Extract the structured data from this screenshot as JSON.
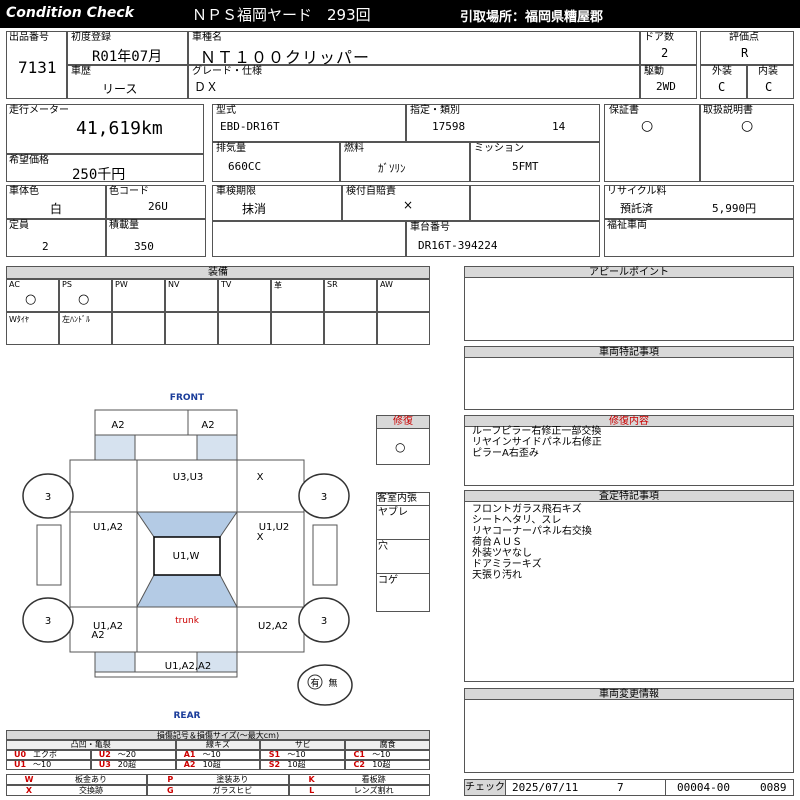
{
  "header": {
    "brand": "Condition Check",
    "auction": "ＮＰＳ福岡ヤード　293回",
    "pickup": "引取場所：福岡県糟屋郡"
  },
  "row1": {
    "lot_label": "出品番号",
    "lot": "7131",
    "first_reg_label": "初度登録",
    "first_reg": "R01年07月",
    "car_name_label": "車種名",
    "car_name": "ＮＴ１００クリッパー",
    "doors_label": "ドア数",
    "doors": "2",
    "rating_label": "評価点",
    "rating": "R",
    "history_label": "車歴",
    "history": "リース",
    "grade_label": "グレード・仕様",
    "grade": "ＤＸ",
    "drive_label": "駆動",
    "drive": "2WD",
    "exterior_label": "外装",
    "exterior": "C",
    "interior_label": "内装",
    "interior": "C"
  },
  "row2": {
    "mileage_label": "走行メーター",
    "mileage": "41,619km",
    "model_label": "型式",
    "model": "EBD-DR16T",
    "designation_label": "指定・類別",
    "designation": "17598",
    "category": "14",
    "warranty_label": "保証書",
    "warranty": "○",
    "manual_label": "取扱説明書",
    "manual": "○",
    "price_label": "希望価格",
    "price": "250千円",
    "displacement_label": "排気量",
    "displacement": "660CC",
    "fuel_label": "燃料",
    "fuel": "ｶﾞｿﾘﾝ",
    "transmission_label": "ミッション",
    "transmission": "5FMT"
  },
  "row3": {
    "body_color_label": "車体色",
    "body_color": "白",
    "color_code_label": "色コード",
    "color_code": "26U",
    "inspection_label": "車検期限",
    "inspection": "抹消",
    "insurance_label": "検付自賠責",
    "insurance": "×",
    "recycle_label": "リサイクル料",
    "recycle_status": "預託済",
    "recycle_fee": "5,990円",
    "capacity_label": "定員",
    "capacity": "2",
    "load_label": "積載量",
    "load": "350",
    "chassis_label": "車台番号",
    "chassis": "DR16T-394224",
    "welfare_label": "福祉車両"
  },
  "equipment": {
    "title": "装備",
    "row1": [
      {
        "name": "AC",
        "val": "○"
      },
      {
        "name": "PS",
        "val": "○"
      },
      {
        "name": "PW",
        "val": ""
      },
      {
        "name": "NV",
        "val": ""
      },
      {
        "name": "TV",
        "val": ""
      },
      {
        "name": "革",
        "val": ""
      },
      {
        "name": "SR",
        "val": ""
      },
      {
        "name": "AW",
        "val": ""
      }
    ],
    "row2": [
      {
        "name": "Wﾀｲﾔ",
        "val": ""
      },
      {
        "name": "左ﾊﾝﾄﾞﾙ",
        "val": ""
      }
    ]
  },
  "diagram": {
    "front": "FRONT",
    "rear": "REAR",
    "top_left": "A2",
    "top_right": "A2",
    "roof_front": "U3,U3",
    "roof_right": "X",
    "left_front": "U1,A2",
    "right_front_a": "U1,U2",
    "right_front_b": "X",
    "center": "U1,W",
    "rear_left_a": "U1,A2",
    "rear_left_b": "A2",
    "trunk": "trunk",
    "rear_right": "U2,A2",
    "rear_bumper": "U1,A2,A2",
    "tire_fl": "3",
    "tire_fr": "3",
    "tire_rl": "3",
    "tire_rr": "3",
    "spare_a": "有",
    "spare_b": "無"
  },
  "repair": {
    "title": "修復",
    "value": "○"
  },
  "interior_box": {
    "title": "客室内張",
    "items": [
      "ヤブレ",
      "穴",
      "コゲ"
    ]
  },
  "appeal": {
    "title": "アピールポイント"
  },
  "special_notes": {
    "title": "車両特記事項"
  },
  "repair_details": {
    "title": "修復内容",
    "lines": [
      "ルーフピラー右修正一部交換",
      "リヤインサイドパネル右修正",
      "ピラーA右歪み"
    ]
  },
  "inspection_notes": {
    "title": "査定特記事項",
    "lines": [
      "フロントガラス飛石キズ",
      "シートヘタリ、スレ",
      "リヤコーナーパネル右交換",
      "荷台ＡＵＳ",
      "外装ツヤなし",
      "ドアミラーキズ",
      "天張り汚れ"
    ]
  },
  "change_info": {
    "title": "車両変更情報"
  },
  "legend": {
    "title": "損傷記号＆損傷サイズ(～最大cm)",
    "heads": [
      "凸凹・亀裂",
      "線キズ",
      "サビ",
      "腐食"
    ],
    "rows": [
      [
        [
          "U0",
          "エクボ"
        ],
        [
          "U2",
          "～20"
        ],
        [
          "A1",
          "～10"
        ],
        [
          "S1",
          "～10"
        ],
        [
          "C1",
          "～10"
        ]
      ],
      [
        [
          "U1",
          "～10"
        ],
        [
          "U3",
          "20超"
        ],
        [
          "A2",
          "10超"
        ],
        [
          "S2",
          "10超"
        ],
        [
          "C2",
          "10超"
        ]
      ]
    ],
    "marks": [
      [
        [
          "W",
          "板金あり"
        ],
        [
          "P",
          "塗装あり"
        ],
        [
          "K",
          "看板跡"
        ]
      ],
      [
        [
          "X",
          "交換跡"
        ],
        [
          "G",
          "ガラスヒビ"
        ],
        [
          "L",
          "レンズ割れ"
        ]
      ]
    ]
  },
  "footer": {
    "check_label": "チェック",
    "date": "2025/07/11",
    "num": "7",
    "code_a": "00004-00",
    "code_b": "0089"
  }
}
